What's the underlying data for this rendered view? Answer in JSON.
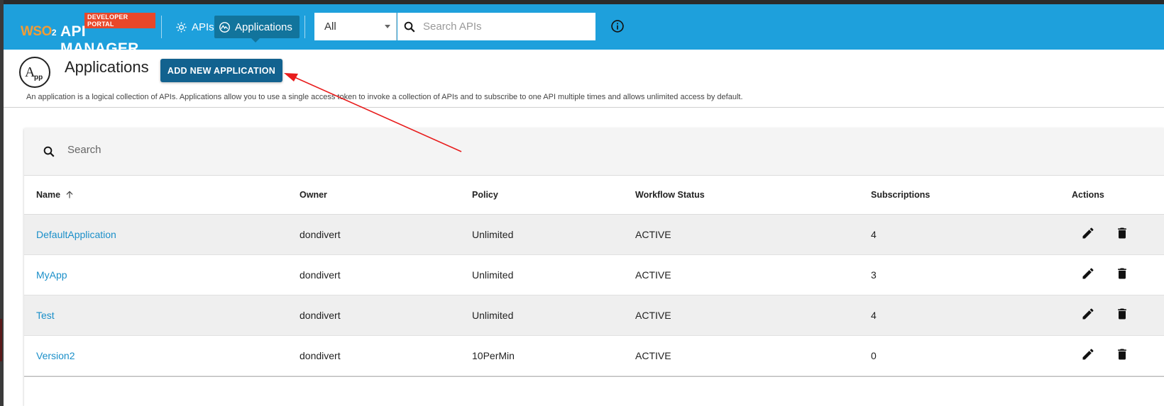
{
  "header": {
    "badge": "DEVELOPER PORTAL",
    "brand_prefix": "WSO",
    "brand_sub": "2",
    "brand_name": "API MANAGER",
    "nav": [
      {
        "label": "APIs",
        "icon": "gear-icon",
        "active": false
      },
      {
        "label": "Applications",
        "icon": "applications-icon",
        "active": true
      }
    ],
    "scope_select": {
      "value": "All"
    },
    "search": {
      "placeholder": "Search APIs"
    },
    "info_icon": "info-icon",
    "colors": {
      "bar": "#1ea0dc",
      "active_nav": "#12749c",
      "badge": "#e8472a",
      "logo_accent": "#f39c34"
    }
  },
  "page": {
    "logo_text": "App",
    "title": "Applications",
    "add_button": "ADD NEW APPLICATION",
    "description": "An application is a logical collection of APIs. Applications allow you to use a single access token to invoke a collection of APIs and to subscribe to one API multiple times and allows unlimited access by default."
  },
  "table": {
    "search_placeholder": "Search",
    "columns": [
      "Name",
      "Owner",
      "Policy",
      "Workflow Status",
      "Subscriptions",
      "Actions"
    ],
    "sort": {
      "column": "Name",
      "direction": "ascending"
    },
    "rows": [
      {
        "name": "DefaultApplication",
        "owner": "dondivert",
        "policy": "Unlimited",
        "status": "ACTIVE",
        "subscriptions": "4"
      },
      {
        "name": "MyApp",
        "owner": "dondivert",
        "policy": "Unlimited",
        "status": "ACTIVE",
        "subscriptions": "3"
      },
      {
        "name": "Test",
        "owner": "dondivert",
        "policy": "Unlimited",
        "status": "ACTIVE",
        "subscriptions": "4"
      },
      {
        "name": "Version2",
        "owner": "dondivert",
        "policy": "10PerMin",
        "status": "ACTIVE",
        "subscriptions": "0"
      }
    ],
    "row_actions": [
      "edit-icon",
      "delete-icon"
    ],
    "link_color": "#1a8fc9"
  },
  "annotation": {
    "type": "red-arrow",
    "points_to": "add-new-application-button",
    "color": "#e81c1c"
  }
}
